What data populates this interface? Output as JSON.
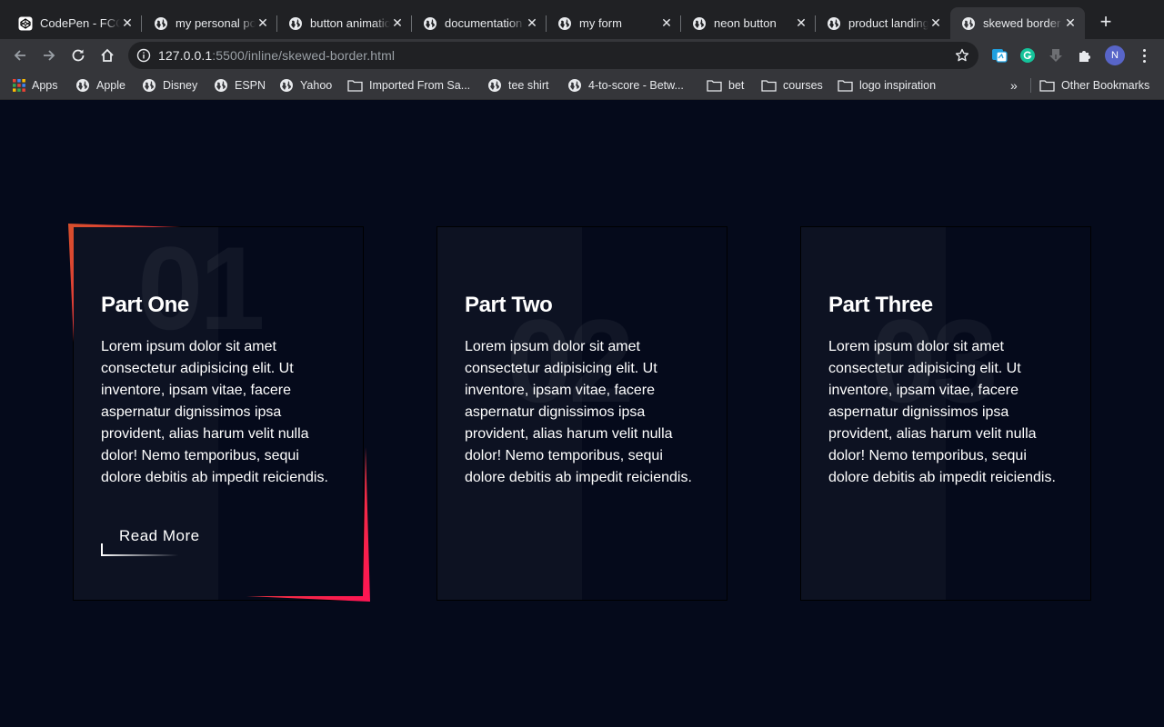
{
  "browser": {
    "tabs": [
      {
        "title": "CodePen - FCC",
        "icon": "codepen-icon"
      },
      {
        "title": "my personal portfolio",
        "icon": "globe-icon"
      },
      {
        "title": "button animation",
        "icon": "globe-icon"
      },
      {
        "title": "documentation",
        "icon": "globe-icon"
      },
      {
        "title": "my form",
        "icon": "globe-icon"
      },
      {
        "title": "neon button",
        "icon": "globe-icon"
      },
      {
        "title": "product landing",
        "icon": "globe-icon"
      },
      {
        "title": "skewed border",
        "icon": "globe-icon",
        "active": true
      }
    ],
    "address": {
      "host": "127.0.0.1",
      "path": ":5500/inline/skewed-border.html"
    },
    "profile_initial": "N",
    "bookmarks": [
      {
        "label": "Apps",
        "icon": "apps-grid-icon"
      },
      {
        "label": "Apple",
        "icon": "globe-icon"
      },
      {
        "label": "Disney",
        "icon": "globe-icon"
      },
      {
        "label": "ESPN",
        "icon": "globe-icon"
      },
      {
        "label": "Yahoo",
        "icon": "globe-icon"
      },
      {
        "label": "Imported From Sa...",
        "icon": "folder-icon"
      },
      {
        "label": "tee shirt",
        "icon": "globe-icon"
      },
      {
        "label": "4-to-score - Betw...",
        "icon": "globe-icon"
      },
      {
        "label": "bet",
        "icon": "folder-icon"
      },
      {
        "label": "courses",
        "icon": "folder-icon"
      },
      {
        "label": "logo inspiration",
        "icon": "folder-icon"
      }
    ],
    "overflow_label": "»",
    "other_bookmarks": "Other Bookmarks"
  },
  "cards": [
    {
      "number": "01",
      "title": "Part One",
      "text": "Lorem ipsum dolor sit amet consectetur adipisicing elit. Ut inventore, ipsam vitae, facere aspernatur dignissimos ipsa provident, alias harum velit nulla dolor! Nemo temporibus, sequi dolore debitis ab impedit reiciendis.",
      "button": "Read More"
    },
    {
      "number": "02",
      "title": "Part Two",
      "text": "Lorem ipsum dolor sit amet consectetur adipisicing elit. Ut inventore, ipsam vitae, facere aspernatur dignissimos ipsa provident, alias harum velit nulla dolor! Nemo temporibus, sequi dolore debitis ab impedit reiciendis."
    },
    {
      "number": "03",
      "title": "Part Three",
      "text": "Lorem ipsum dolor sit amet consectetur adipisicing elit. Ut inventore, ipsam vitae, facere aspernatur dignissimos ipsa provident, alias harum velit nulla dolor! Nemo temporibus, sequi dolore debitis ab impedit reiciendis."
    }
  ],
  "colors": {
    "page_bg": "#050a1b",
    "card_stripe": "#0d1222",
    "border_gradient_start": "#e2532d",
    "border_gradient_end": "#ff1454"
  }
}
